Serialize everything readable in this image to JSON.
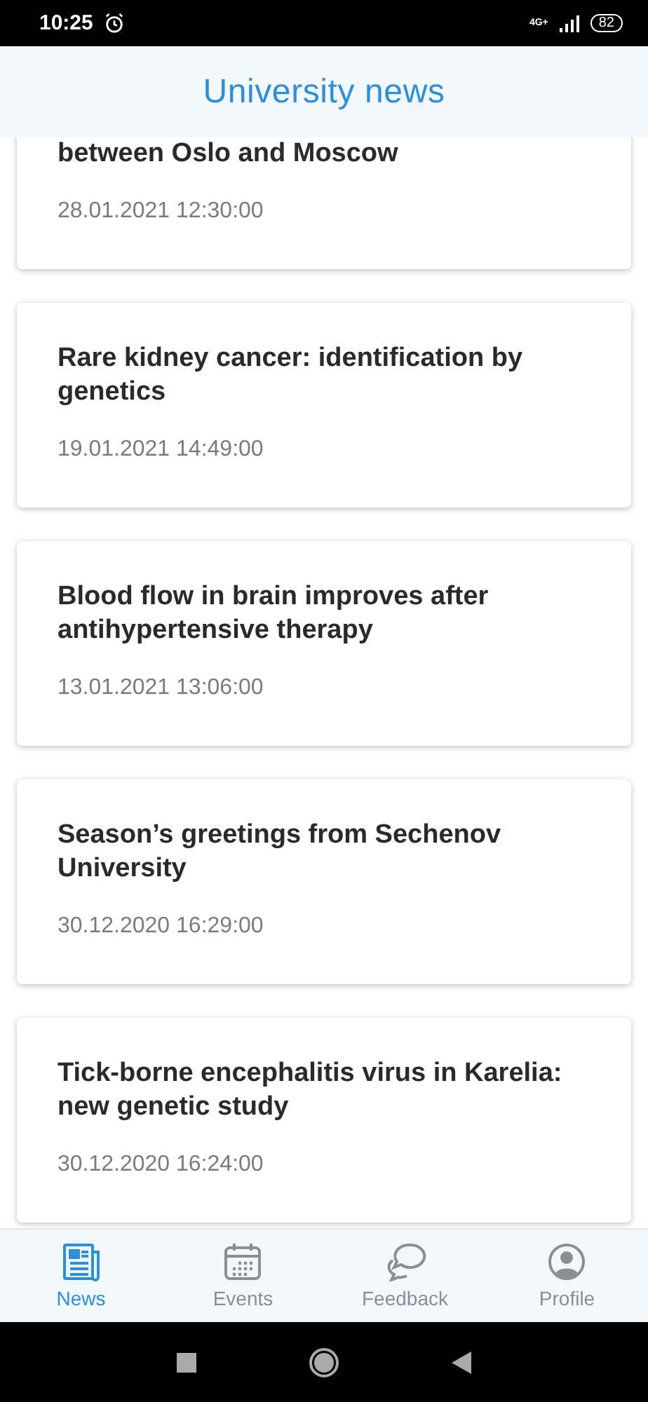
{
  "status_bar": {
    "time": "10:25",
    "network": "4G+",
    "battery": "82"
  },
  "header": {
    "title": "University news"
  },
  "news": [
    {
      "title": "between Oslo and Moscow",
      "date": "28.01.2021 12:30:00"
    },
    {
      "title": "Rare kidney cancer: identification by genetics",
      "date": "19.01.2021 14:49:00"
    },
    {
      "title": "Blood flow in brain improves after antihypertensive therapy",
      "date": "13.01.2021 13:06:00"
    },
    {
      "title": "Season’s greetings from Sechenov University",
      "date": "30.12.2020 16:29:00"
    },
    {
      "title": "Tick-borne encephalitis virus in Karelia: new genetic study",
      "date": "30.12.2020 16:24:00"
    }
  ],
  "tabs": [
    {
      "kind": "news",
      "label": "News",
      "selected": true
    },
    {
      "kind": "events",
      "label": "Events",
      "selected": false
    },
    {
      "kind": "feedback",
      "label": "Feedback",
      "selected": false
    },
    {
      "kind": "profile",
      "label": "Profile",
      "selected": false
    }
  ]
}
